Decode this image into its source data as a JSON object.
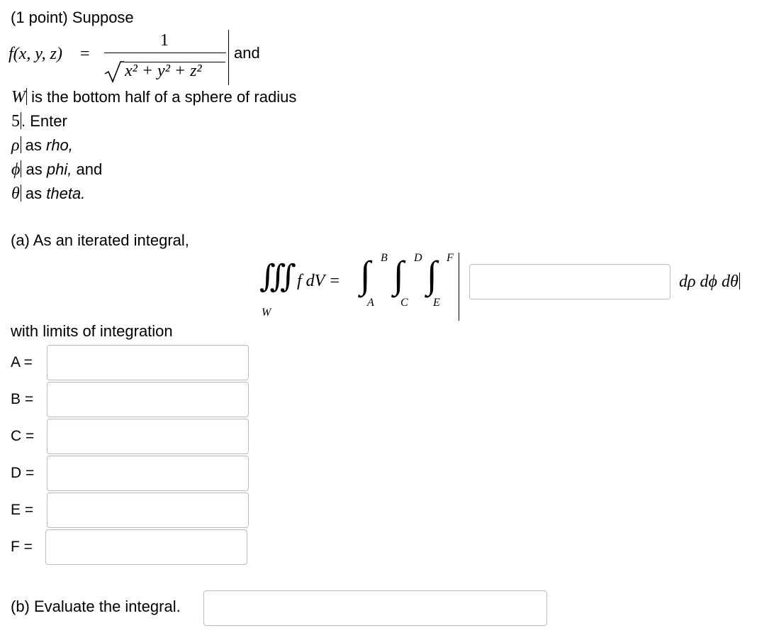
{
  "problem": {
    "header": "(1 point) Suppose",
    "f_lhs": "f(x, y, z)",
    "equals": "=",
    "numerator": "1",
    "radicand": "x² + y² + z²",
    "and": "and",
    "w_symbol": "W",
    "w_text": " is the bottom half of a sphere of radius",
    "radius": "5",
    "enter_text": ". Enter",
    "rho_symbol": "ρ",
    "rho_text": " as ",
    "rho_name": "rho,",
    "phi_symbol": "ϕ",
    "phi_text": " as ",
    "phi_name": "phi,",
    "phi_tail": " and",
    "theta_symbol": "θ",
    "theta_text": " as ",
    "theta_name": "theta."
  },
  "part_a": {
    "label": "(a) As an iterated integral,",
    "triple_integral": "∭",
    "f_dv": "f dV =",
    "region": "W",
    "integral_sign": "∫",
    "limit_B": "B",
    "limit_A": "A",
    "limit_D": "D",
    "limit_C": "C",
    "limit_F": "F",
    "limit_E": "E",
    "differentials": "dρ dϕ dθ",
    "integrand_value": ""
  },
  "limits": {
    "label": "with limits of integration",
    "rows": [
      {
        "label": "A =",
        "value": ""
      },
      {
        "label": "B =",
        "value": ""
      },
      {
        "label": "C =",
        "value": ""
      },
      {
        "label": "D =",
        "value": ""
      },
      {
        "label": "E =",
        "value": ""
      },
      {
        "label": "F =",
        "value": ""
      }
    ]
  },
  "part_b": {
    "label": "(b) Evaluate the integral.",
    "value": ""
  }
}
